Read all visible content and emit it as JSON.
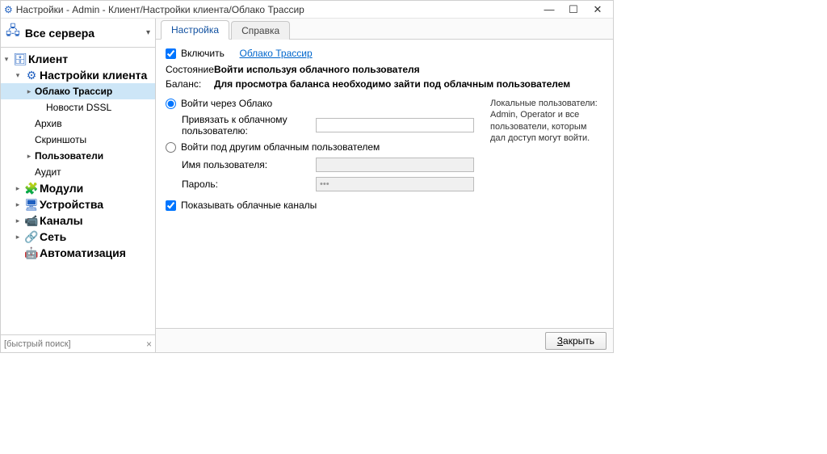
{
  "window": {
    "title": "Настройки - Admin - Клиент/Настройки клиента/Облако Трассир"
  },
  "sidebar": {
    "header": "Все сервера",
    "items": [
      {
        "label": "Клиент",
        "depth": 0,
        "chev": "v",
        "icon": "db",
        "bold": true,
        "big": true
      },
      {
        "label": "Настройки клиента",
        "depth": 1,
        "chev": "v",
        "icon": "gear",
        "bold": true,
        "big": true
      },
      {
        "label": "Облако Трассир",
        "depth": 2,
        "chev": ">",
        "icon": "",
        "bold": true,
        "selected": true
      },
      {
        "label": "Новости DSSL",
        "depth": 3,
        "chev": "",
        "icon": ""
      },
      {
        "label": "Архив",
        "depth": 2,
        "chev": "",
        "icon": ""
      },
      {
        "label": "Скриншоты",
        "depth": 2,
        "chev": "",
        "icon": ""
      },
      {
        "label": "Пользователи",
        "depth": 2,
        "chev": ">",
        "icon": "",
        "bold": true
      },
      {
        "label": "Аудит",
        "depth": 2,
        "chev": "",
        "icon": ""
      },
      {
        "label": "Модули",
        "depth": 1,
        "chev": ">",
        "icon": "puzzle",
        "bold": true,
        "big": true
      },
      {
        "label": "Устройства",
        "depth": 1,
        "chev": ">",
        "icon": "devices",
        "bold": true,
        "big": true
      },
      {
        "label": "Каналы",
        "depth": 1,
        "chev": ">",
        "icon": "camera",
        "bold": true,
        "big": true
      },
      {
        "label": "Сеть",
        "depth": 1,
        "chev": ">",
        "icon": "network",
        "bold": true,
        "big": true
      },
      {
        "label": "Автоматизация",
        "depth": 1,
        "chev": "",
        "icon": "robot",
        "bold": true,
        "big": true
      }
    ],
    "search_placeholder": "[быстрый поиск]"
  },
  "tabs": [
    {
      "label": "Настройка",
      "active": true
    },
    {
      "label": "Справка",
      "active": false
    }
  ],
  "main": {
    "enable_label": "Включить",
    "enable_checked": true,
    "cloud_link": "Облако Трассир",
    "status_label": "Состояние:",
    "status_value": "Войти используя облачного пользователя",
    "balance_label": "Баланс:",
    "balance_value": "Для просмотра баланса необходимо зайти под облачным пользователем",
    "radio1": "Войти через Облако",
    "radio1_sub_label": "Привязать к облачному пользователю:",
    "radio1_sub_value": "",
    "radio2": "Войти под другим облачным пользователем",
    "username_label": "Имя пользователя:",
    "username_value": "",
    "password_label": "Пароль:",
    "password_value": "***",
    "show_channels_label": "Показывать облачные каналы",
    "show_channels_checked": true,
    "sidebar_note": "Локальные пользователи: Admin, Operator и все пользователи, которым дал доступ могут войти."
  },
  "footer": {
    "close_label_prefix": "З",
    "close_label_rest": "акрыть"
  },
  "icons": {
    "db": "🗄",
    "gear": "⚙",
    "puzzle": "🧩",
    "devices": "🖥",
    "camera": "📹",
    "network": "🔗",
    "robot": "🤖",
    "servers": "🖧"
  }
}
